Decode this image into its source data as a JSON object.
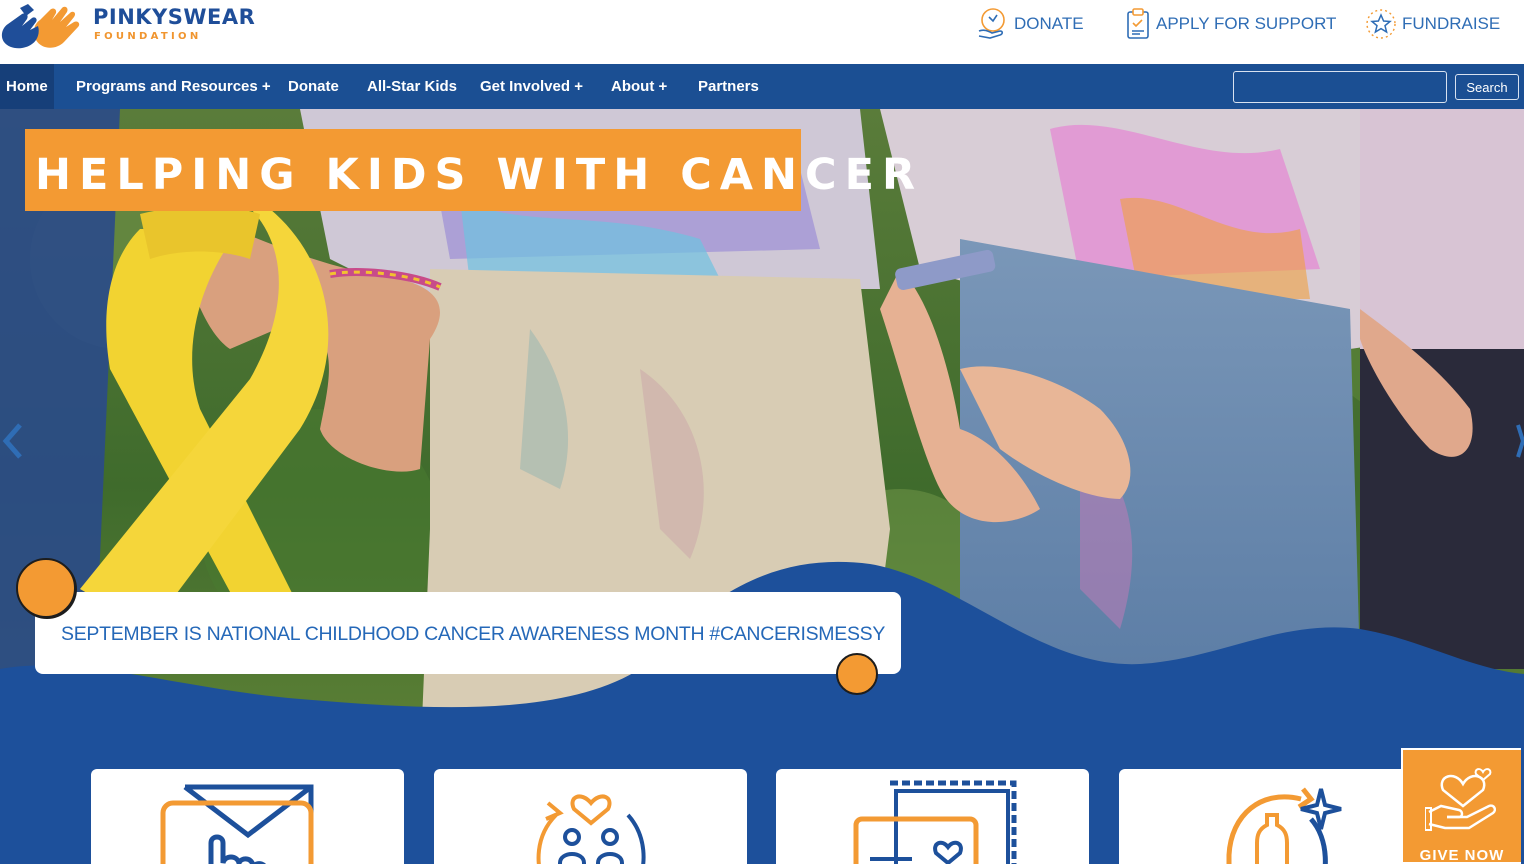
{
  "header": {
    "logo_name": "PINKYSWEAR",
    "logo_sub": "FOUNDATION",
    "utility": [
      {
        "label": "DONATE",
        "icon": "donate-hand-icon"
      },
      {
        "label": "APPLY FOR SUPPORT",
        "icon": "clipboard-icon"
      },
      {
        "label": "FUNDRAISE",
        "icon": "star-icon"
      }
    ]
  },
  "nav": {
    "items": [
      {
        "label": "Home",
        "active": true
      },
      {
        "label": "Programs and Resources +"
      },
      {
        "label": "Donate"
      },
      {
        "label": "All-Star Kids"
      },
      {
        "label": "Get Involved +"
      },
      {
        "label": "About +"
      },
      {
        "label": "Partners"
      }
    ],
    "search_value": "",
    "search_button": "Search"
  },
  "hero": {
    "title": "HELPING KIDS WITH CANCER",
    "banner": "SEPTEMBER IS NATIONAL CHILDHOOD CANCER AWARENESS MONTH #CANCERISMESSY"
  },
  "cards": [
    {
      "icon": "envelope-hand-icon"
    },
    {
      "icon": "heart-family-icon"
    },
    {
      "icon": "stamp-card-icon"
    },
    {
      "icon": "recycle-bottle-icon"
    }
  ],
  "give_now": {
    "label": "GIVE NOW",
    "icon": "heart-hand-icon"
  },
  "colors": {
    "brand_blue": "#1b4f93",
    "accent_orange": "#f39a33",
    "link_blue": "#2f6db5",
    "ribbon_yellow": "#f2d331"
  }
}
